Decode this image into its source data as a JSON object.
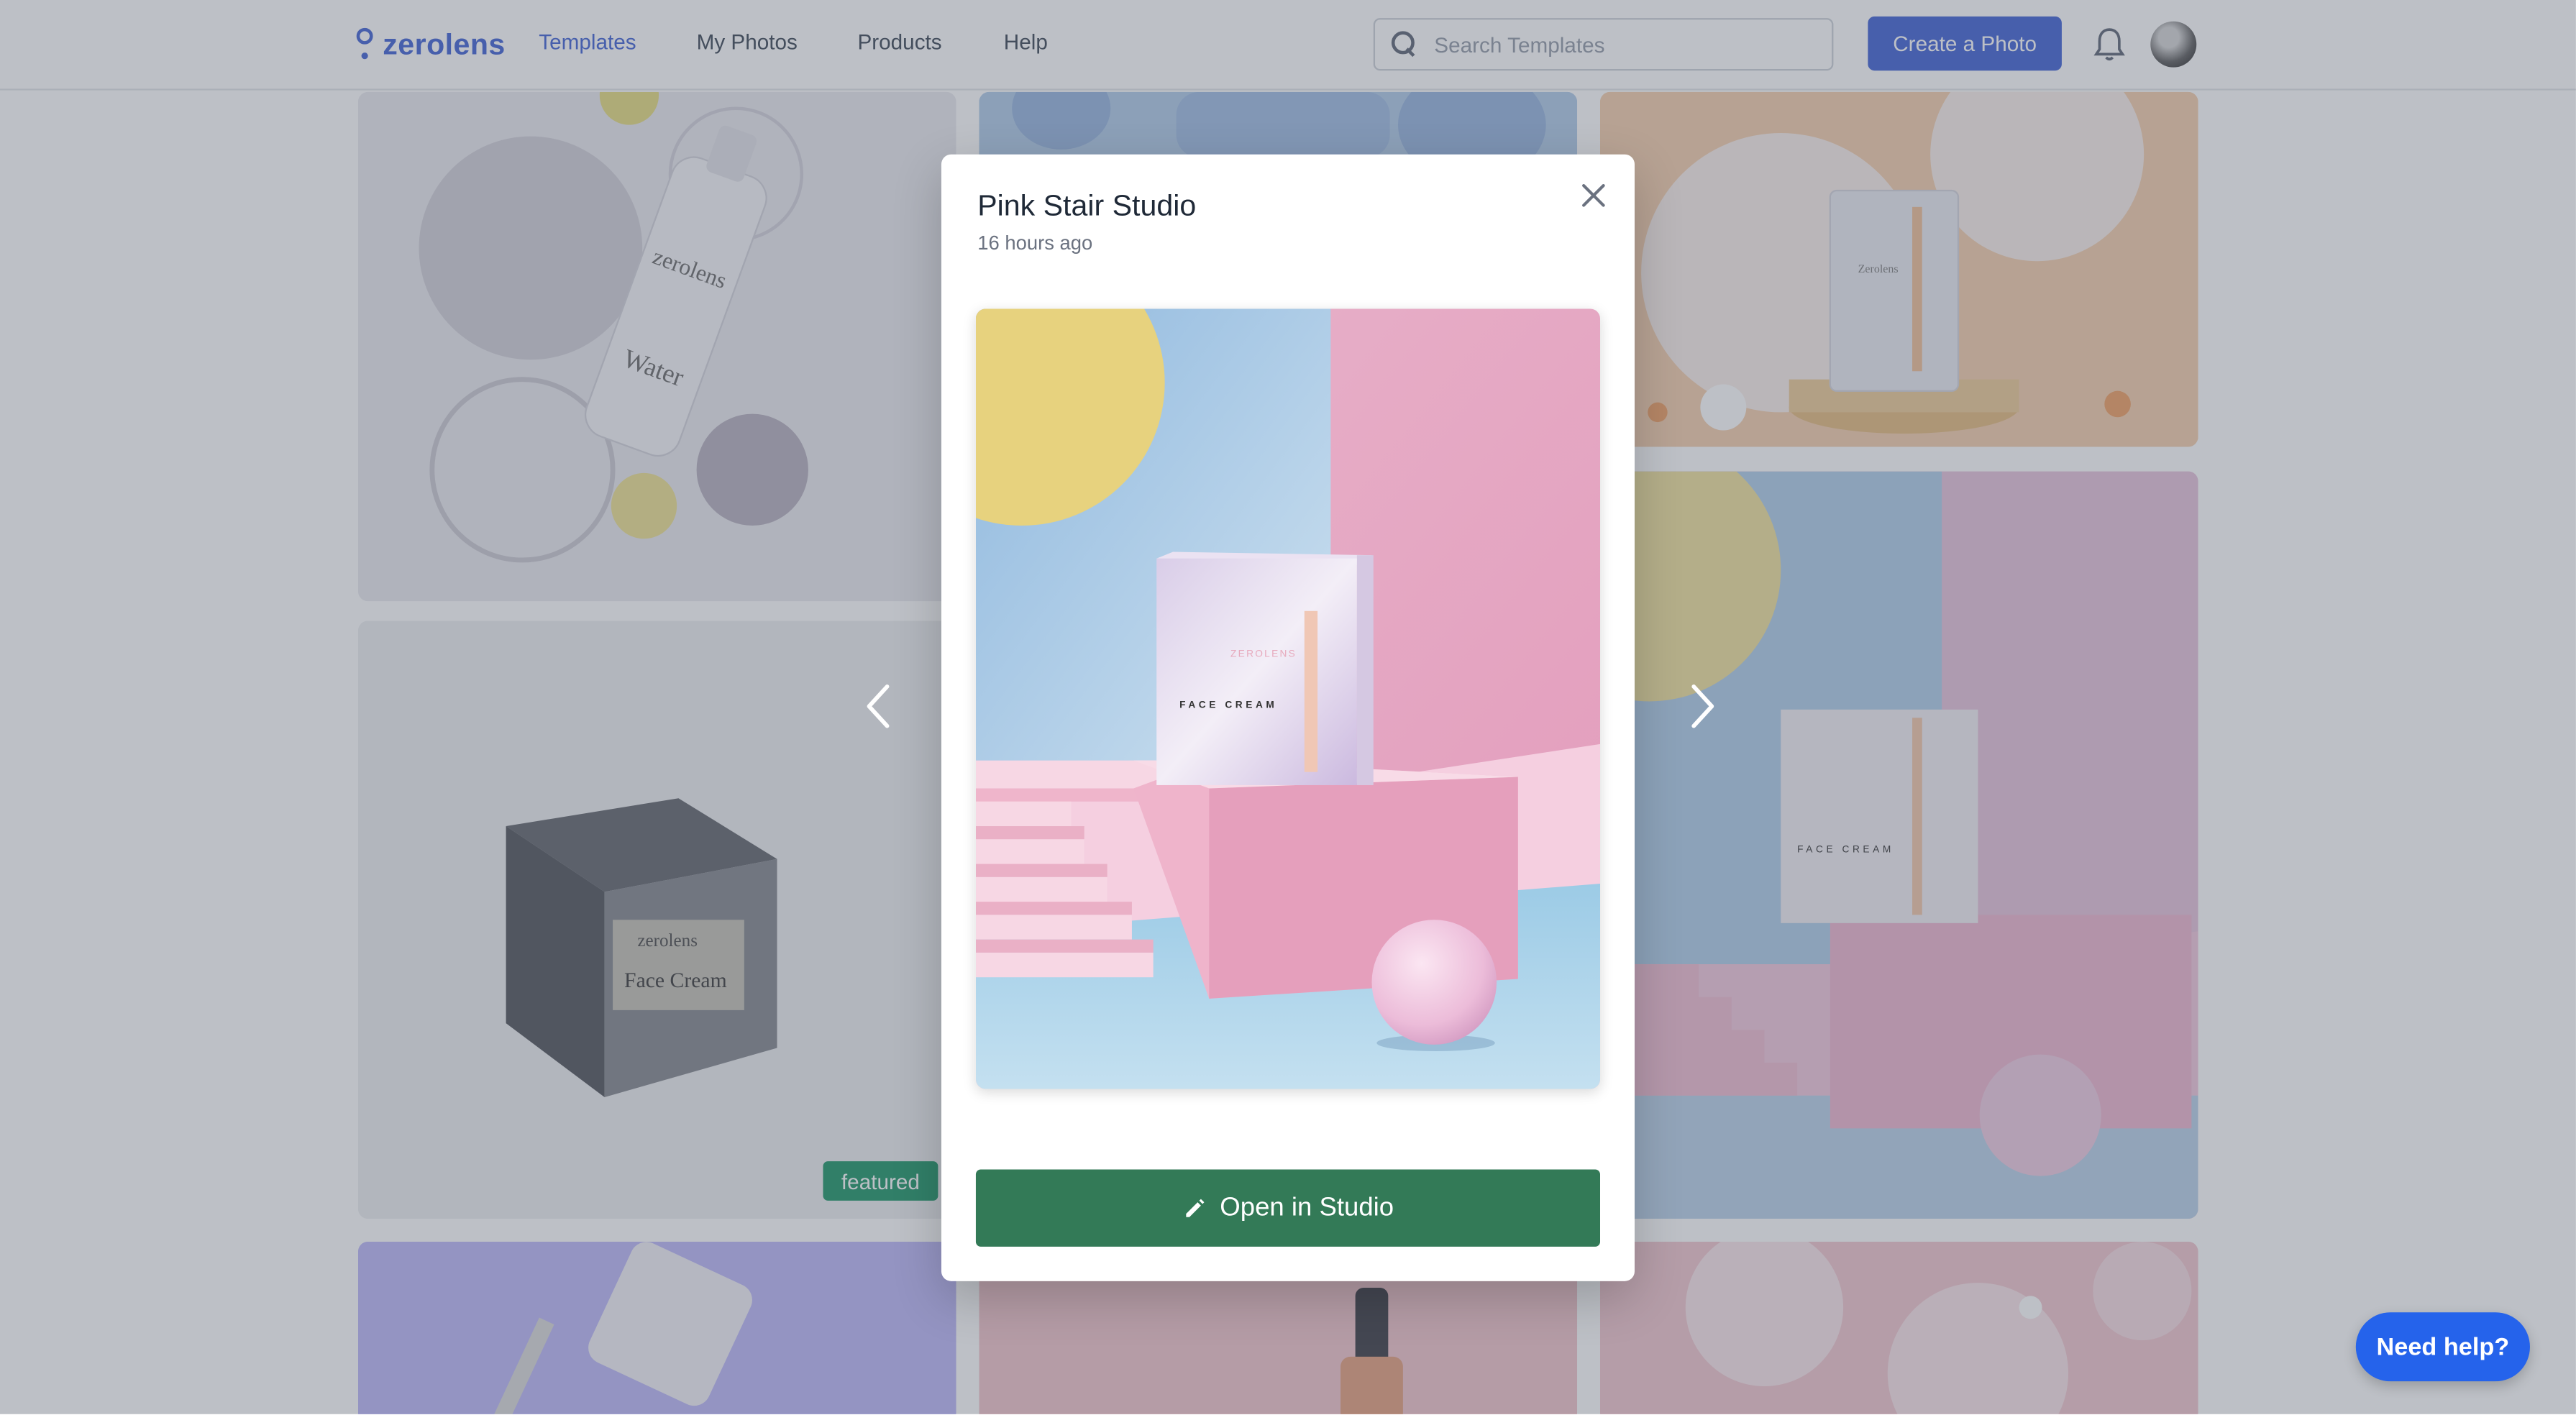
{
  "header": {
    "logo_text": "zerolens",
    "nav": [
      "Templates",
      "My Photos",
      "Products",
      "Help"
    ],
    "search_placeholder": "Search Templates",
    "cta_label": "Create a Photo"
  },
  "grid": {
    "featured_badge": "featured",
    "tile_texts": {
      "bottle_brand": "zerolens",
      "bottle_label": "Water",
      "box_brand": "zerolens",
      "box_label": "Face Cream",
      "pouch_brand": "Zerolens",
      "pink_box_label": "FACE CREAM"
    }
  },
  "modal": {
    "title": "Pink Stair Studio",
    "time": "16 hours ago",
    "preview": {
      "box_brand": "ZEROLENS",
      "box_label": "FACE CREAM"
    },
    "open_label": "Open in Studio"
  },
  "help_button": "Need help?",
  "colors": {
    "brand": "#4f6fd8",
    "open_button": "#337a57",
    "help_button": "#2563eb",
    "featured_badge": "#2f9e73"
  },
  "icons": {
    "search": "search-icon",
    "bell": "bell-icon",
    "close": "close-icon",
    "prev": "chevron-left-icon",
    "next": "chevron-right-icon",
    "pencil": "pencil-icon"
  }
}
